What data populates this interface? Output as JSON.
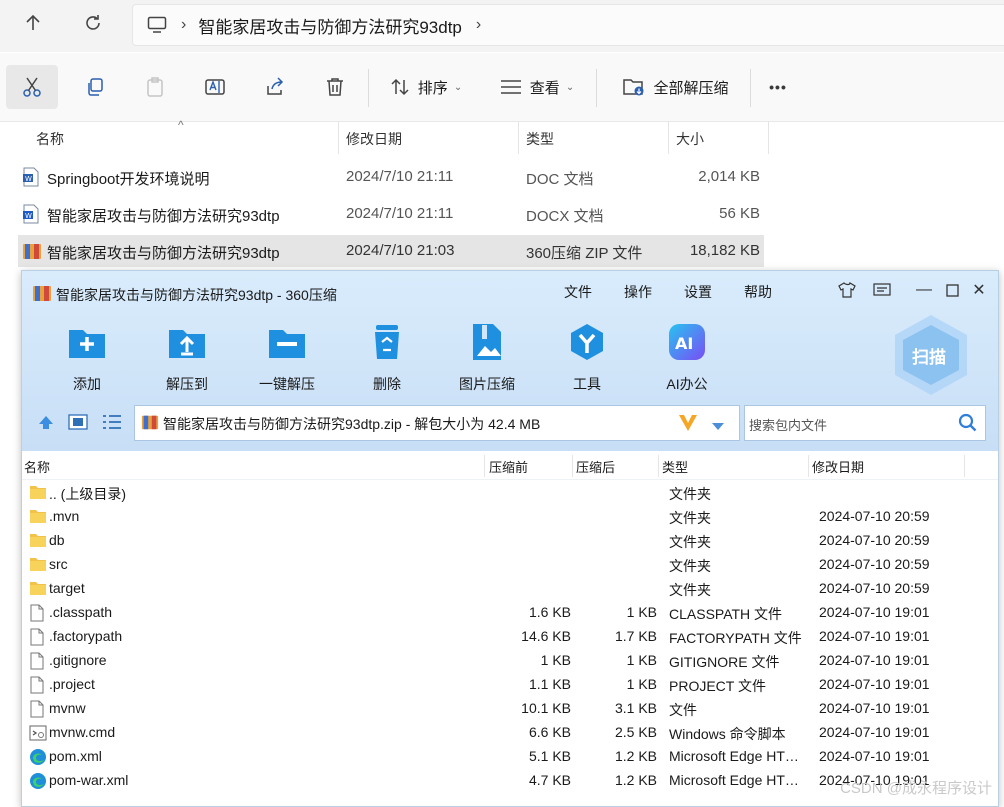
{
  "explorer": {
    "breadcrumb": "智能家居攻击与防御方法研究93dtp",
    "toolbar": {
      "sort_label": "排序",
      "view_label": "查看",
      "extract_all_label": "全部解压缩",
      "more_label": "•••"
    },
    "columns": {
      "name": "名称",
      "date": "修改日期",
      "type": "类型",
      "size": "大小"
    },
    "files": [
      {
        "name": "Springboot开发环境说明",
        "date": "2024/7/10 21:11",
        "type": "DOC 文档",
        "size": "2,014 KB",
        "icon": "word-doc-icon"
      },
      {
        "name": "智能家居攻击与防御方法研究93dtp",
        "date": "2024/7/10 21:11",
        "type": "DOCX 文档",
        "size": "56 KB",
        "icon": "word-docx-icon"
      },
      {
        "name": "智能家居攻击与防御方法研究93dtp",
        "date": "2024/7/10 21:03",
        "type": "360压缩 ZIP 文件",
        "size": "18,182 KB",
        "icon": "zip-archive-icon",
        "selected": true
      }
    ]
  },
  "zip_window": {
    "title": "智能家居攻击与防御方法研究93dtp - 360压缩",
    "menu": [
      "文件",
      "操作",
      "设置",
      "帮助"
    ],
    "tools": [
      {
        "label": "添加",
        "icon": "add-icon"
      },
      {
        "label": "解压到",
        "icon": "extract-to-icon"
      },
      {
        "label": "一键解压",
        "icon": "one-click-extract-icon"
      },
      {
        "label": "删除",
        "icon": "recycle-delete-icon"
      },
      {
        "label": "图片压缩",
        "icon": "image-compress-icon"
      },
      {
        "label": "工具",
        "icon": "tools-icon"
      },
      {
        "label": "AI办公",
        "icon": "ai-office-icon"
      }
    ],
    "scan_label": "扫描",
    "path": "智能家居攻击与防御方法研究93dtp.zip - 解包大小为 42.4 MB",
    "search_placeholder": "搜索包内文件",
    "columns": {
      "name": "名称",
      "compressed_before": "压缩前",
      "compressed_after": "压缩后",
      "type": "类型",
      "date": "修改日期"
    },
    "rows": [
      {
        "name": ".. (上级目录)",
        "before": "",
        "after": "",
        "type": "文件夹",
        "date": "",
        "icon": "folder-icon"
      },
      {
        "name": ".mvn",
        "before": "",
        "after": "",
        "type": "文件夹",
        "date": "2024-07-10 20:59",
        "icon": "folder-icon"
      },
      {
        "name": "db",
        "before": "",
        "after": "",
        "type": "文件夹",
        "date": "2024-07-10 20:59",
        "icon": "folder-icon"
      },
      {
        "name": "src",
        "before": "",
        "after": "",
        "type": "文件夹",
        "date": "2024-07-10 20:59",
        "icon": "folder-icon"
      },
      {
        "name": "target",
        "before": "",
        "after": "",
        "type": "文件夹",
        "date": "2024-07-10 20:59",
        "icon": "folder-icon"
      },
      {
        "name": ".classpath",
        "before": "1.6 KB",
        "after": "1 KB",
        "type": "CLASSPATH 文件",
        "date": "2024-07-10 19:01",
        "icon": "file-icon"
      },
      {
        "name": ".factorypath",
        "before": "14.6 KB",
        "after": "1.7 KB",
        "type": "FACTORYPATH 文件",
        "date": "2024-07-10 19:01",
        "icon": "file-icon"
      },
      {
        "name": ".gitignore",
        "before": "1 KB",
        "after": "1 KB",
        "type": "GITIGNORE 文件",
        "date": "2024-07-10 19:01",
        "icon": "file-icon"
      },
      {
        "name": ".project",
        "before": "1.1 KB",
        "after": "1 KB",
        "type": "PROJECT 文件",
        "date": "2024-07-10 19:01",
        "icon": "file-icon"
      },
      {
        "name": "mvnw",
        "before": "10.1 KB",
        "after": "3.1 KB",
        "type": "文件",
        "date": "2024-07-10 19:01",
        "icon": "file-icon"
      },
      {
        "name": "mvnw.cmd",
        "before": "6.6 KB",
        "after": "2.5 KB",
        "type": "Windows 命令脚本",
        "date": "2024-07-10 19:01",
        "icon": "cmd-script-icon"
      },
      {
        "name": "pom.xml",
        "before": "5.1 KB",
        "after": "1.2 KB",
        "type": "Microsoft Edge HT…",
        "date": "2024-07-10 19:01",
        "icon": "edge-icon"
      },
      {
        "name": "pom-war.xml",
        "before": "4.7 KB",
        "after": "1.2 KB",
        "type": "Microsoft Edge HT…",
        "date": "2024-07-10 19:01",
        "icon": "edge-icon"
      }
    ]
  },
  "watermark": "CSDN @成永程序设计"
}
